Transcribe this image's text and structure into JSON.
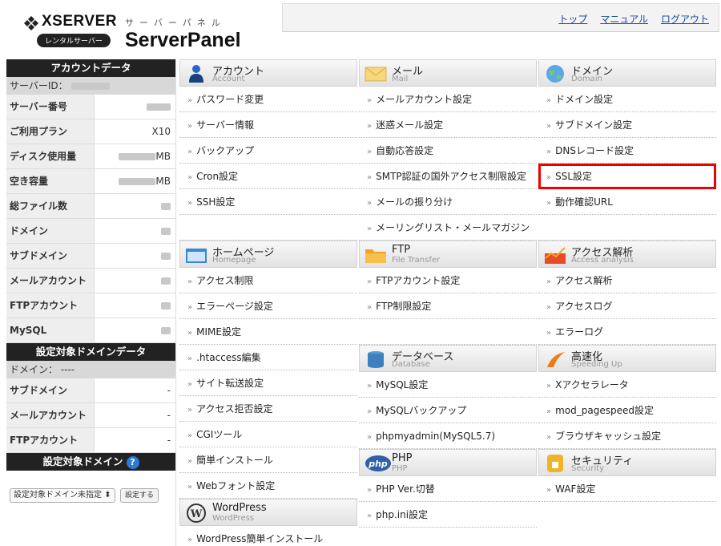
{
  "header": {
    "logo_text": "XSERVER",
    "logo_badge": "レンタルサーバー",
    "panel_sub": "サーバーパネル",
    "panel_title": "ServerPanel",
    "links": [
      "トップ",
      "マニュアル",
      "ログアウト"
    ]
  },
  "sidebar": {
    "account_title": "アカウントデータ",
    "server_id_label": "サーバーID：",
    "account_rows": [
      {
        "label": "サーバー番号",
        "value": ""
      },
      {
        "label": "ご利用プラン",
        "value": "X10"
      },
      {
        "label": "ディスク使用量",
        "value": "MB"
      },
      {
        "label": "空き容量",
        "value": "MB"
      },
      {
        "label": "総ファイル数",
        "value": ""
      },
      {
        "label": "ドメイン",
        "value": ""
      },
      {
        "label": "サブドメイン",
        "value": ""
      },
      {
        "label": "メールアカウント",
        "value": ""
      },
      {
        "label": "FTPアカウント",
        "value": ""
      },
      {
        "label": "MySQL",
        "value": ""
      }
    ],
    "domain_data_title": "設定対象ドメインデータ",
    "domain_label": "ドメイン： ----",
    "domain_rows": [
      {
        "label": "サブドメイン",
        "value": "-"
      },
      {
        "label": "メールアカウント",
        "value": "-"
      },
      {
        "label": "FTPアカウント",
        "value": "-"
      }
    ],
    "domain_select_title": "設定対象ドメイン",
    "help_icon": "?",
    "domain_select_value": "設定対象ドメイン未指定",
    "domain_set_button": "設定する"
  },
  "columns": {
    "c1": [
      {
        "title": "アカウント",
        "sub": "Account",
        "icon": "user-icon",
        "items": [
          "パスワード変更",
          "サーバー情報",
          "バックアップ",
          "Cron設定",
          "SSH設定",
          ""
        ]
      },
      {
        "title": "ホームページ",
        "sub": "Homepage",
        "icon": "homepage-icon",
        "items": [
          "アクセス制限",
          "エラーページ設定",
          "MIME設定",
          ".htaccess編集",
          "サイト転送設定",
          "アクセス拒否設定",
          "CGIツール",
          "簡単インストール",
          "Webフォント設定"
        ]
      },
      {
        "title": "WordPress",
        "sub": "WordPress",
        "icon": "wordpress-icon",
        "items": [
          "WordPress簡単インストール"
        ]
      }
    ],
    "c2": [
      {
        "title": "メール",
        "sub": "Mail",
        "icon": "mail-icon",
        "items": [
          "メールアカウント設定",
          "迷惑メール設定",
          "自動応答設定",
          "SMTP認証の国外アクセス制限設定",
          "メールの振り分け",
          "メーリングリスト・メールマガジン"
        ]
      },
      {
        "title": "FTP",
        "sub": "File Transfer",
        "icon": "folder-icon",
        "items": [
          "FTPアカウント設定",
          "FTP制限設定",
          ""
        ]
      },
      {
        "title": "データベース",
        "sub": "Database",
        "icon": "database-icon",
        "items": [
          "MySQL設定",
          "MySQLバックアップ",
          "phpmyadmin(MySQL5.7)"
        ]
      },
      {
        "title": "PHP",
        "sub": "PHP",
        "icon": "php-icon",
        "items": [
          "PHP Ver.切替",
          "php.ini設定"
        ]
      }
    ],
    "c3": [
      {
        "title": "ドメイン",
        "sub": "Domain",
        "icon": "globe-icon",
        "items": [
          "ドメイン設定",
          "サブドメイン設定",
          "DNSレコード設定",
          "SSL設定",
          "動作確認URL",
          ""
        ]
      },
      {
        "title": "アクセス解析",
        "sub": "Access analysis",
        "icon": "analytics-icon",
        "items": [
          "アクセス解析",
          "アクセスログ",
          "エラーログ"
        ]
      },
      {
        "title": "高速化",
        "sub": "Speeding Up",
        "icon": "speed-icon",
        "items": [
          "Xアクセラレータ",
          "mod_pagespeed設定",
          "ブラウザキャッシュ設定"
        ]
      },
      {
        "title": "セキュリティ",
        "sub": "Security",
        "icon": "lock-icon",
        "items": [
          "WAF設定"
        ]
      }
    ]
  },
  "highlight_item": "SSL設定",
  "colors": {
    "highlight": "#e00000",
    "link": "#1a4a9c",
    "sidebar_head": "#222222"
  }
}
